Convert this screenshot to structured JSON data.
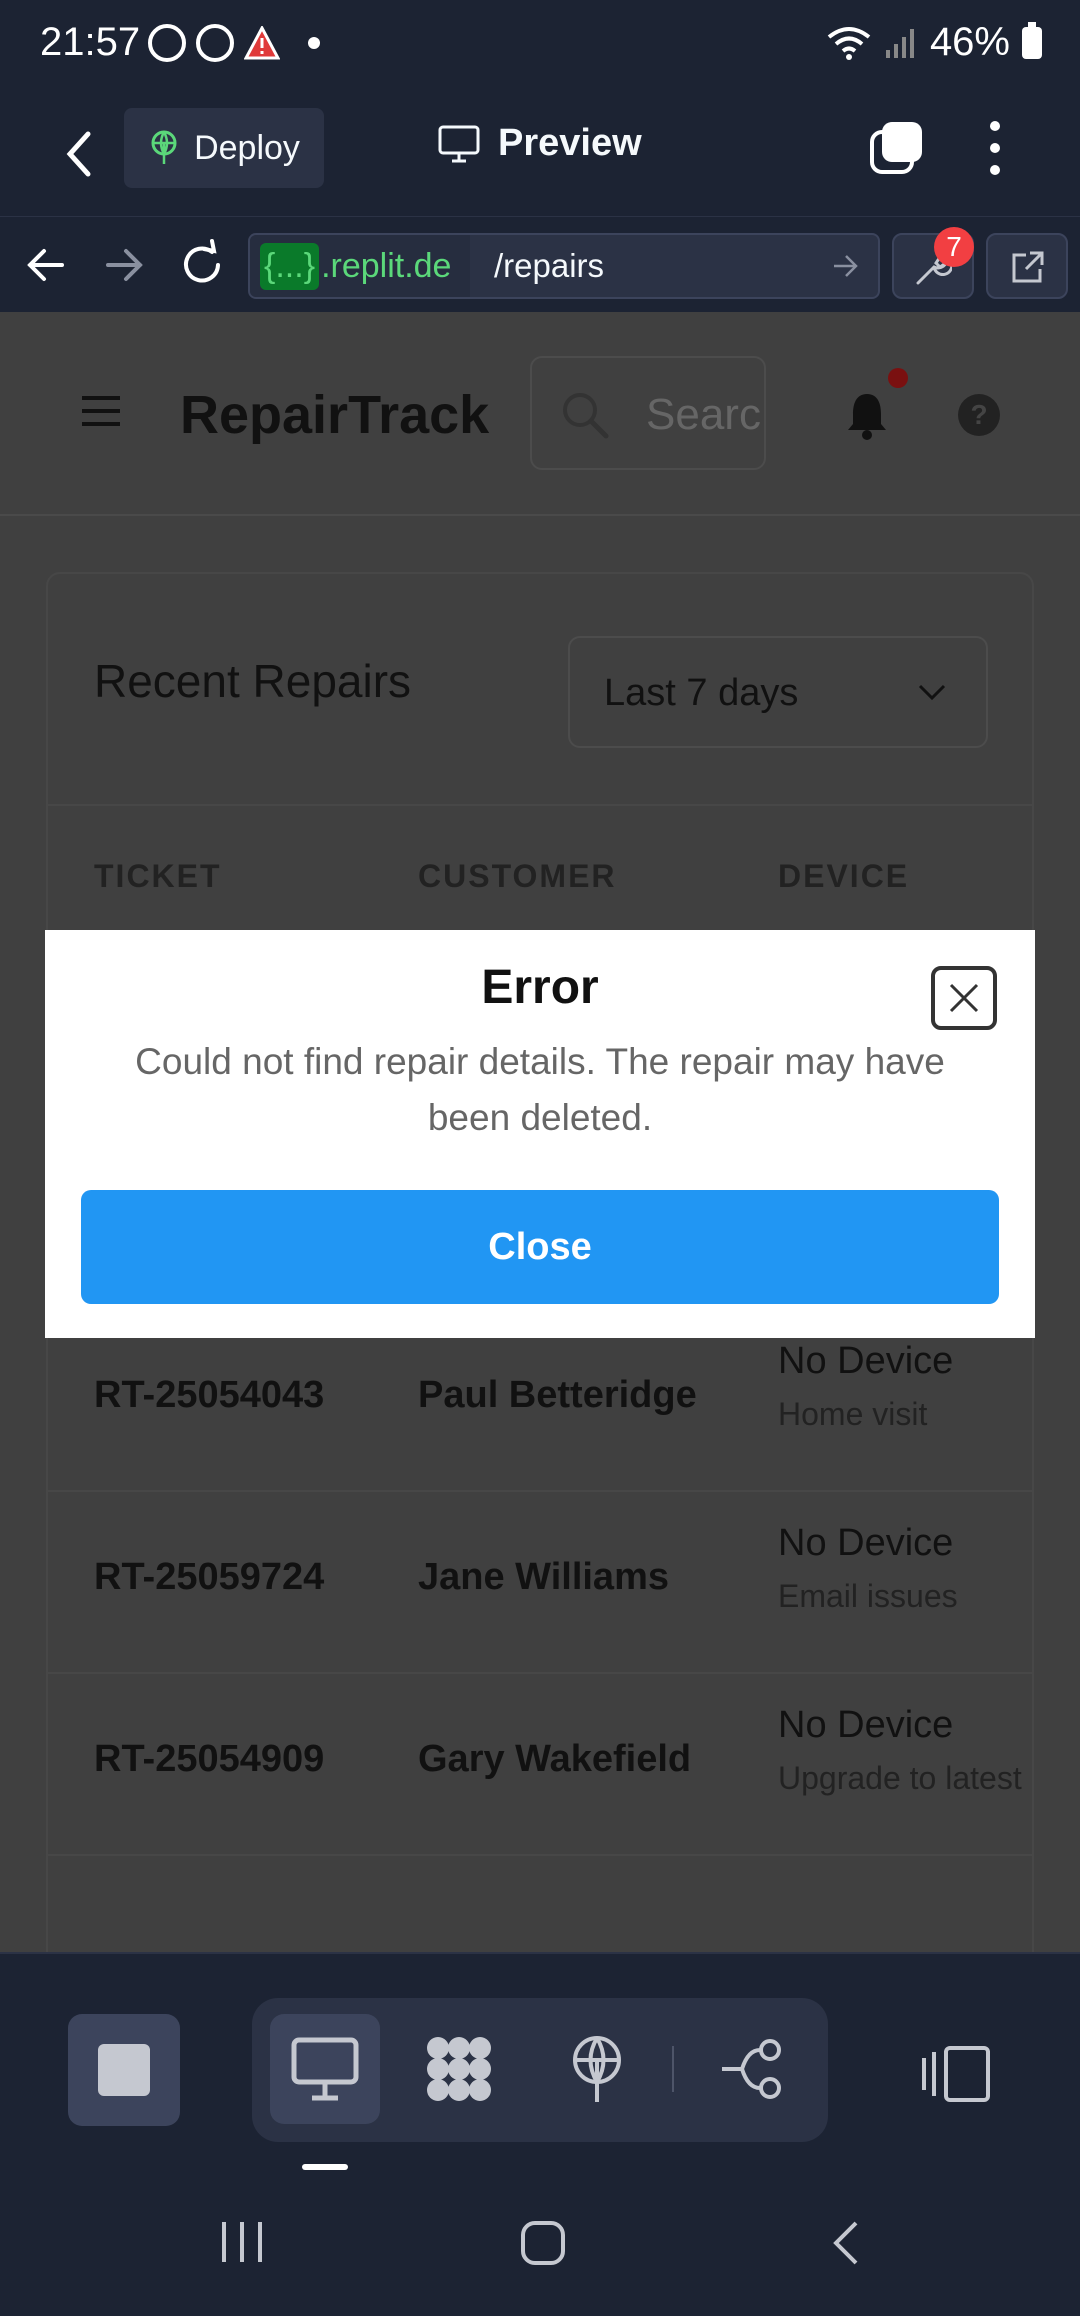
{
  "status_bar": {
    "time": "21:57",
    "battery": "46%"
  },
  "replit_header": {
    "deploy_label": "Deploy",
    "preview_label": "Preview"
  },
  "url_bar": {
    "host_chip": "{...}",
    "host": ".replit.de",
    "path": "/repairs",
    "tools_badge": "7"
  },
  "app": {
    "title": "RepairTrack",
    "search_placeholder": "Search"
  },
  "repairs_card": {
    "title": "Recent Repairs",
    "range_selected": "Last 7 days",
    "columns": [
      "TICKET",
      "CUSTOMER",
      "DEVICE"
    ],
    "rows": [
      {
        "ticket": "RT-25054043",
        "customer": "Paul Betteridge",
        "device": "No Device",
        "issue": "Home visit"
      },
      {
        "ticket": "RT-25059724",
        "customer": "Jane Williams",
        "device": "No Device",
        "issue": "Email issues"
      },
      {
        "ticket": "RT-25054909",
        "customer": "Gary Wakefield",
        "device": "No Device",
        "issue": "Upgrade to latest"
      }
    ]
  },
  "error_modal": {
    "title": "Error",
    "message": "Could not find repair details. The repair may have been deleted.",
    "close_label": "Close"
  },
  "colors": {
    "accent": "#2196f3",
    "replit_bg": "#1c2333",
    "badge": "#f23f42"
  }
}
